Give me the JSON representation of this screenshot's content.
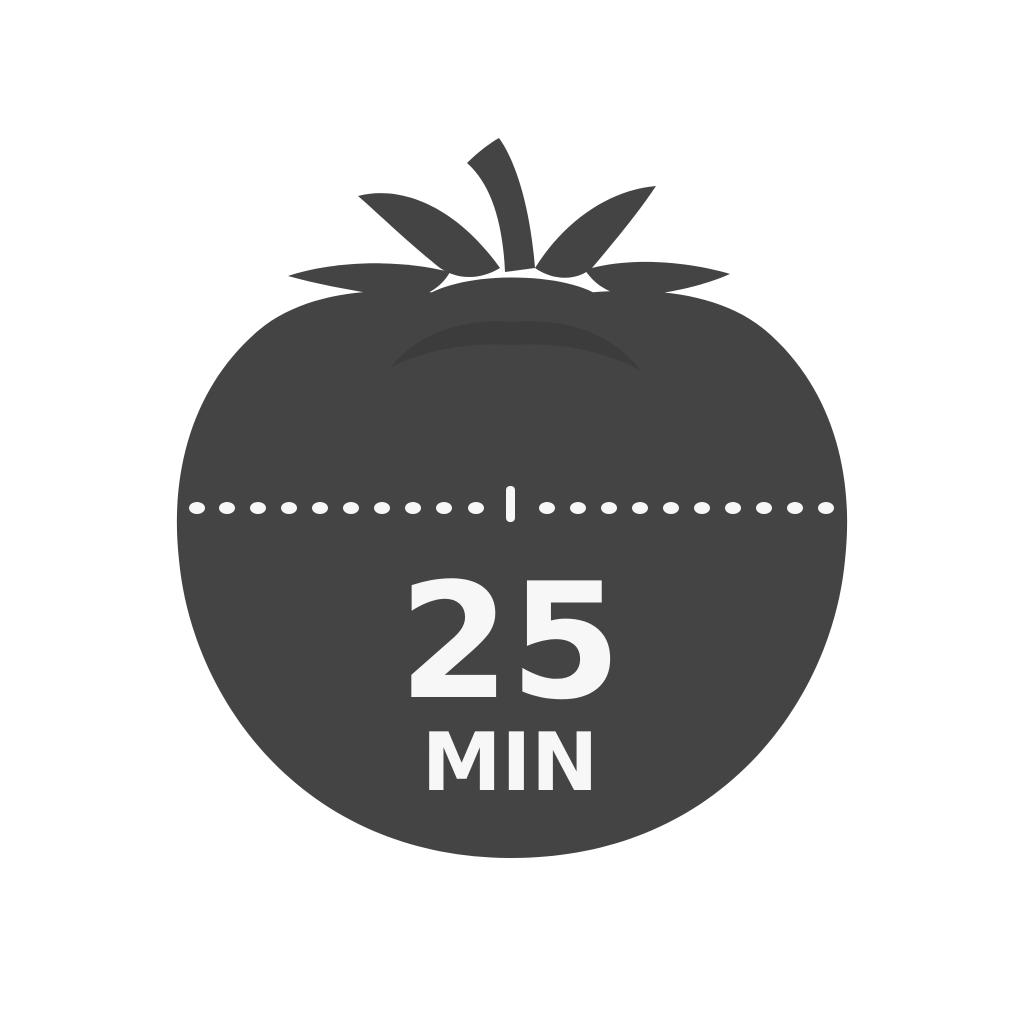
{
  "timer": {
    "minutes": "25",
    "unit": "MIN"
  },
  "icon": {
    "name": "tomato-timer-icon"
  },
  "colors": {
    "background": "#ffffff",
    "body": "#444444",
    "text": "#f7f7f7"
  }
}
